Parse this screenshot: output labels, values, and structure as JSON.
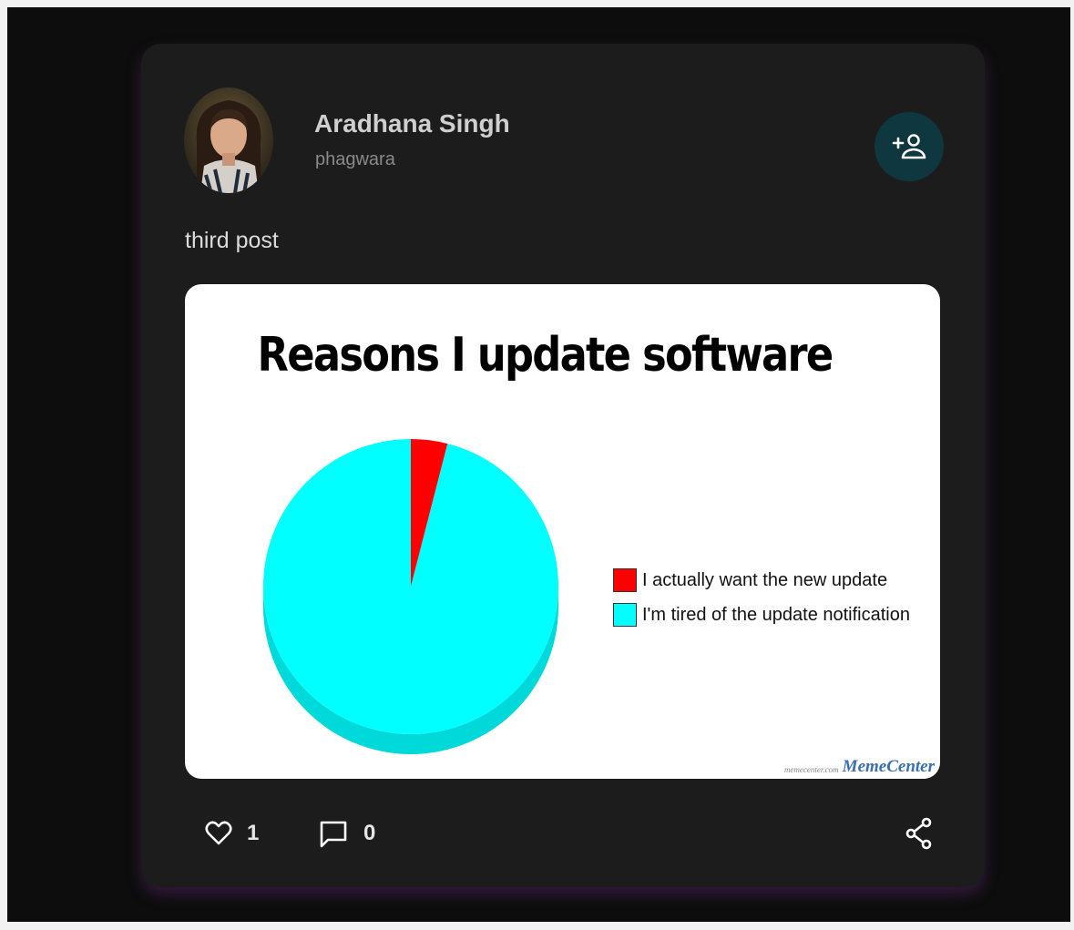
{
  "post": {
    "author": {
      "name": "Aradhana Singh",
      "location": "phagwara"
    },
    "follow_icon": "person-add-icon",
    "text": "third post",
    "image": {
      "title": "Reasons I update software",
      "chart_data": {
        "type": "pie",
        "title": "Reasons I update software",
        "categories": [
          "I actually want the new update",
          "I'm tired of the update notification"
        ],
        "values": [
          4,
          96
        ],
        "colors": [
          "#ff0000",
          "#00ffff"
        ],
        "legend": "right"
      },
      "watermark": {
        "site": "memecenter.com",
        "brand": "MemeCenter"
      }
    },
    "actions": {
      "like_icon": "heart-icon",
      "likes": "1",
      "comment_icon": "comment-icon",
      "comments": "0",
      "share_icon": "share-icon"
    }
  },
  "colors": {
    "background": "#0d0d0d",
    "card": "#1c1c1c",
    "follow_button": "#0f3740",
    "accent": "#5fe0d8"
  }
}
